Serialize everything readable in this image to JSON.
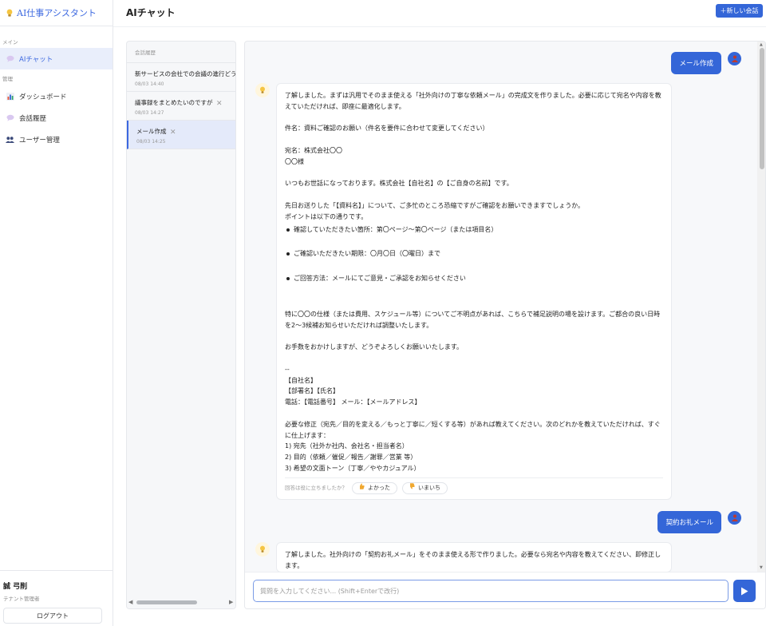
{
  "app": {
    "title": "AI仕事アシスタント"
  },
  "sidebar": {
    "section_main": "メイン",
    "section_manage": "管理",
    "items": [
      {
        "label": "AIチャット",
        "icon": "chat-bubble-icon",
        "active": true
      },
      {
        "label": "ダッシュボード",
        "icon": "bar-chart-icon",
        "active": false
      },
      {
        "label": "会話履歴",
        "icon": "chat-bubble-icon",
        "active": false
      },
      {
        "label": "ユーザー管理",
        "icon": "users-icon",
        "active": false
      }
    ],
    "user_name": "誠 弓削",
    "user_role": "テナント管理者",
    "logout_label": "ログアウト"
  },
  "header": {
    "page_title": "AIチャット",
    "new_chat_label": "＋新しい会話"
  },
  "history": {
    "heading": "会話履歴",
    "items": [
      {
        "title": "新サービスの会社での会議の進行どう",
        "date": "08/03 14:40",
        "active": false
      },
      {
        "title": "議事録をまとめたいのですが",
        "date": "08/03 14:27",
        "active": false
      },
      {
        "title": "メール作成",
        "date": "08/03 14:25",
        "active": true
      }
    ]
  },
  "chat": {
    "messages": [
      {
        "role": "user",
        "text": "メール作成"
      },
      {
        "role": "assistant",
        "intro": "了解しました。まずは汎用でそのまま使える「社外向けの丁寧な依頼メール」の完成文を作りました。必要に応じて宛名や内容を教えていただければ、即座に最適化します。\n\n件名：資料ご確認のお願い（件名を要件に合わせて変更してください）\n\n宛名：株式会社〇〇\n〇〇様\n\nいつもお世話になっております。株式会社【自社名】の【ご自身の名前】です。\n\n先日お送りした「【資料名】」について、ご多忙のところ恐縮ですがご確認をお願いできますでしょうか。\nポイントは以下の通りです。",
        "bullets": [
          "確認していただきたい箇所：第〇ページ〜第〇ページ（または項目名）",
          "ご確認いただきたい期限：〇月〇日（〇曜日）まで",
          "ご回答方法：メールにてご意見・ご承認をお知らせください"
        ],
        "outro": "\n特に〇〇の仕様（または費用、スケジュール等）についてご不明点があれば、こちらで補足説明の場を設けます。ご都合の良い日時を2〜3候補お知らせいただければ調整いたします。\n\nお手数をおかけしますが、どうぞよろしくお願いいたします。\n\n--\n【自社名】\n【部署名】【氏名】\n電話：【電話番号】 メール：【メールアドレス】\n\n必要な修正（宛先／目的を変える／もっと丁寧に／短くする等）があれば教えてください。次のどれかを教えていただければ、すぐに仕上げます：\n1) 宛先（社外か社内、会社名・担当者名）\n2) 目的（依頼／催促／報告／謝罪／営業 等）\n3) 希望の文面トーン（丁寧／ややカジュアル）",
        "feedback_prompt": "回答は役に立ちましたか？",
        "good_label": "よかった",
        "bad_label": "いまいち"
      },
      {
        "role": "user",
        "text": "契約お礼メール"
      },
      {
        "role": "assistant",
        "intro": "了解しました。社外向けの「契約お礼メール」をそのまま使える形で作りました。必要なら宛名や内容を教えてください、即修正します。"
      }
    ],
    "input_placeholder": "質問を入力してください... (Shift+Enterで改行)",
    "input_value": ""
  },
  "colors": {
    "accent": "#3466d8",
    "active_bg": "#e9eefb"
  }
}
